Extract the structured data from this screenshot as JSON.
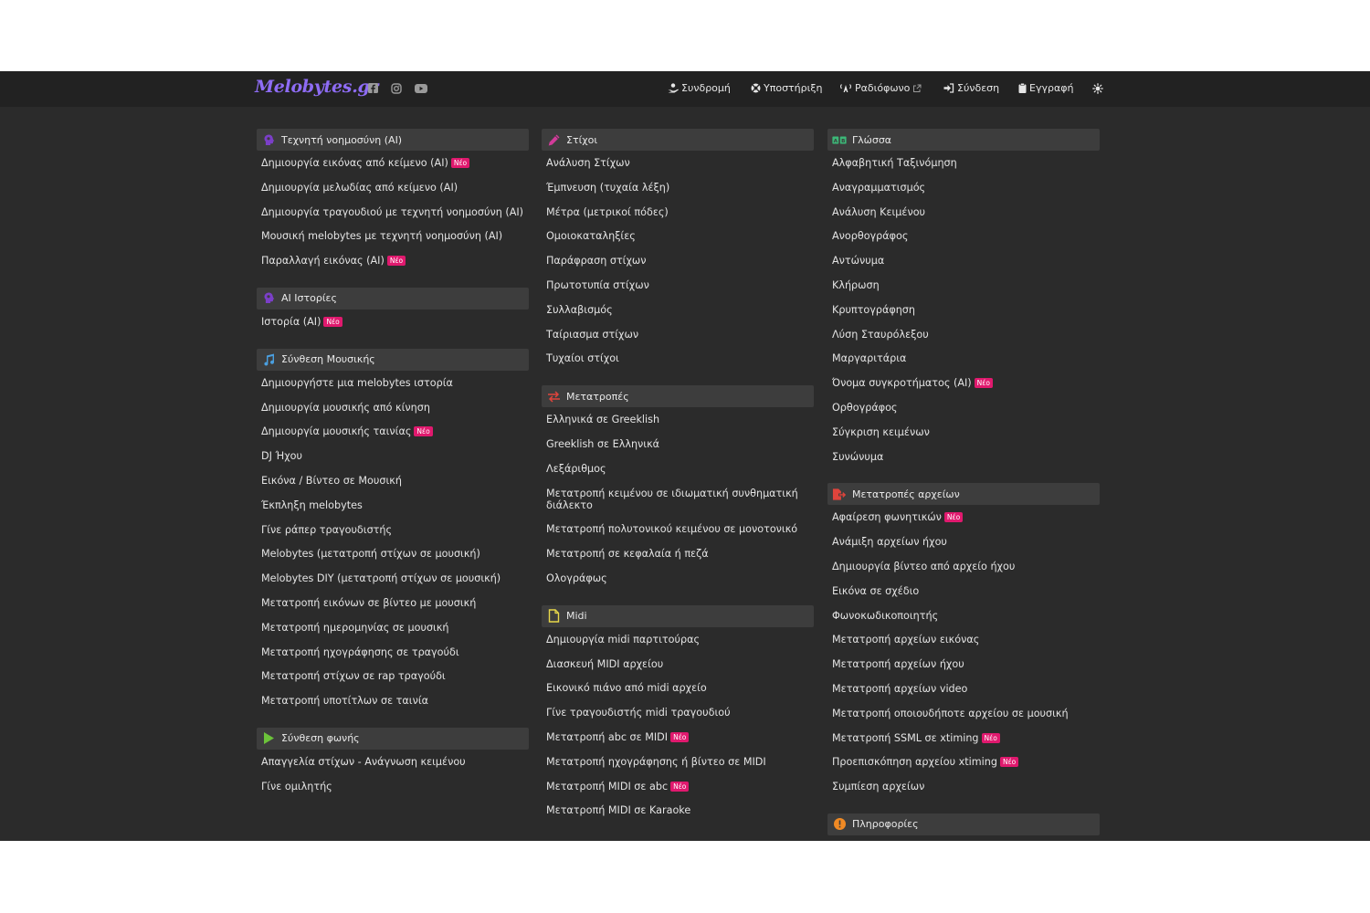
{
  "header": {
    "logo": "Melobytes.gr",
    "social_icons": [
      "facebook-icon",
      "instagram-icon",
      "youtube-icon"
    ],
    "nav": [
      {
        "label": "Συνδρομή",
        "icon": "subscription-hand-icon"
      },
      {
        "label": "Υποστήριξη",
        "icon": "lifebuoy-icon"
      },
      {
        "label": "Ραδιόφωνο",
        "icon": "radio-antenna-icon",
        "external": true
      },
      {
        "label": "Σύνδεση",
        "icon": "sign-in-icon"
      },
      {
        "label": "Εγγραφή",
        "icon": "clipboard-icon"
      }
    ],
    "theme_icon": "sun-icon"
  },
  "badge_label": "Νέο",
  "colors": {
    "page_bg": "#2b2b2b",
    "navbar_bg": "#222222",
    "section_header_bg": "#3d3d3d",
    "logo": "#8e6cf5",
    "badge": "#e0196e"
  },
  "columns": [
    {
      "sections": [
        {
          "title": "Τεχνητή νοημοσύνη (AI)",
          "icon": "ai-brain-icon",
          "icon_color": "#7b3fc8",
          "items": [
            {
              "label": "Δημιουργία εικόνας από κείμενο (AI)",
              "new": true
            },
            {
              "label": "Δημιουργία μελωδίας από κείμενο (AI)"
            },
            {
              "label": "Δημιουργία τραγουδιού με τεχνητή νοημοσύνη (AI)"
            },
            {
              "label": "Μουσική melobytes με τεχνητή νοημοσύνη (AI)"
            },
            {
              "label": "Παραλλαγή εικόνας (AI)",
              "new": true
            }
          ]
        },
        {
          "title": "AI Ιστορίες",
          "icon": "ai-brain-icon",
          "icon_color": "#7b3fc8",
          "items": [
            {
              "label": "Ιστορία (AI)",
              "new": true
            }
          ]
        },
        {
          "title": "Σύνθεση Μουσικής",
          "icon": "music-note-icon",
          "icon_color": "#4a9fe0",
          "items": [
            {
              "label": "Δημιουργήστε μια melobytes ιστορία"
            },
            {
              "label": "Δημιουργία μουσικής από κίνηση"
            },
            {
              "label": "Δημιουργία μουσικής ταινίας",
              "new": true
            },
            {
              "label": "DJ Ήχου"
            },
            {
              "label": "Εικόνα / Βίντεο σε Μουσική"
            },
            {
              "label": "Έκπληξη melobytes"
            },
            {
              "label": "Γίνε ράπερ τραγουδιστής"
            },
            {
              "label": "Melobytes (μετατροπή στίχων σε μουσική)"
            },
            {
              "label": "Melobytes DIY (μετατροπή στίχων σε μουσική)"
            },
            {
              "label": "Μετατροπή εικόνων σε βίντεο με μουσική"
            },
            {
              "label": "Μετατροπή ημερομηνίας σε μουσική"
            },
            {
              "label": "Μετατροπή ηχογράφησης σε τραγούδι"
            },
            {
              "label": "Μετατροπή στίχων σε rap τραγούδι"
            },
            {
              "label": "Μετατροπή υποτίτλων σε ταινία"
            }
          ]
        },
        {
          "title": "Σύνθεση φωνής",
          "icon": "play-triangle-icon",
          "icon_color": "#6cc33a",
          "items": [
            {
              "label": "Απαγγελία στίχων - Ανάγνωση κειμένου"
            },
            {
              "label": "Γίνε ομιλητής"
            }
          ]
        }
      ]
    },
    {
      "sections": [
        {
          "title": "Στίχοι",
          "icon": "pencil-icon",
          "icon_color": "#d23b9a",
          "items": [
            {
              "label": "Ανάλυση Στίχων"
            },
            {
              "label": "Έμπνευση (τυχαία λέξη)"
            },
            {
              "label": "Μέτρα (μετρικοί πόδες)"
            },
            {
              "label": "Ομοιοκαταληξίες"
            },
            {
              "label": "Παράφραση στίχων"
            },
            {
              "label": "Πρωτοτυπία στίχων"
            },
            {
              "label": "Συλλαβισμός"
            },
            {
              "label": "Ταίριασμα στίχων"
            },
            {
              "label": "Τυχαίοι στίχοι"
            }
          ]
        },
        {
          "title": "Μετατροπές",
          "icon": "swap-arrows-icon",
          "icon_color": "#e0443c",
          "items": [
            {
              "label": "Ελληνικά σε Greeklish"
            },
            {
              "label": "Greeklish σε Ελληνικά"
            },
            {
              "label": "Λεξάριθμος"
            },
            {
              "label": "Μετατροπή κειμένου σε ιδιωματική συνθηματική διάλεκτο",
              "wrap": true
            },
            {
              "label": "Μετατροπή πολυτονικού κειμένου σε μονοτονικό"
            },
            {
              "label": "Μετατροπή σε κεφαλαία ή πεζά"
            },
            {
              "label": "Ολογράφως"
            }
          ]
        },
        {
          "title": "Midi",
          "icon": "file-icon",
          "icon_color": "#e8d84a",
          "items": [
            {
              "label": "Δημιουργία midi παρτιτούρας"
            },
            {
              "label": "Διασκευή MIDI αρχείου"
            },
            {
              "label": "Εικονικό πιάνο από midi αρχείο"
            },
            {
              "label": "Γίνε τραγουδιστής midi τραγουδιού"
            },
            {
              "label": "Μετατροπή abc σε MIDI",
              "new": true
            },
            {
              "label": "Μετατροπή ηχογράφησης ή βίντεο σε MIDI"
            },
            {
              "label": "Μετατροπή MIDI σε abc",
              "new": true
            },
            {
              "label": "Μετατροπή MIDI σε Karaoke"
            }
          ]
        }
      ]
    },
    {
      "sections": [
        {
          "title": "Γλώσσα",
          "icon": "language-ab-icon",
          "icon_color": "#3cb878",
          "items": [
            {
              "label": "Αλφαβητική Ταξινόμηση"
            },
            {
              "label": "Αναγραμματισμός"
            },
            {
              "label": "Ανάλυση Κειμένου"
            },
            {
              "label": "Ανορθογράφος"
            },
            {
              "label": "Αντώνυμα"
            },
            {
              "label": "Κλήρωση"
            },
            {
              "label": "Κρυπτογράφηση"
            },
            {
              "label": "Λύση Σταυρόλεξου"
            },
            {
              "label": "Μαργαριτάρια"
            },
            {
              "label": "Όνομα συγκροτήματος (AI)",
              "new": true
            },
            {
              "label": "Ορθογράφος"
            },
            {
              "label": "Σύγκριση κειμένων"
            },
            {
              "label": "Συνώνυμα"
            }
          ]
        },
        {
          "title": "Μετατροπές αρχείων",
          "icon": "file-export-icon",
          "icon_color": "#e0443c",
          "items": [
            {
              "label": "Αφαίρεση φωνητικών",
              "new": true
            },
            {
              "label": "Ανάμιξη αρχείων ήχου"
            },
            {
              "label": "Δημιουργία βίντεο από αρχείο ήχου"
            },
            {
              "label": "Εικόνα σε σχέδιο"
            },
            {
              "label": "Φωνοκωδικοποιητής"
            },
            {
              "label": "Μετατροπή αρχείων εικόνας"
            },
            {
              "label": "Μετατροπή αρχείων ήχου"
            },
            {
              "label": "Μετατροπή αρχείων video"
            },
            {
              "label": "Μετατροπή οποιουδήποτε αρχείου σε μουσική"
            },
            {
              "label": "Μετατροπή SSML σε xtiming",
              "new": true
            },
            {
              "label": "Προεπισκόπηση αρχείου xtiming",
              "new": true
            },
            {
              "label": "Συμπίεση αρχείων"
            }
          ]
        },
        {
          "title": "Πληροφορίες",
          "icon": "info-circle-icon",
          "icon_color": "#f08a24",
          "items": []
        }
      ]
    }
  ]
}
